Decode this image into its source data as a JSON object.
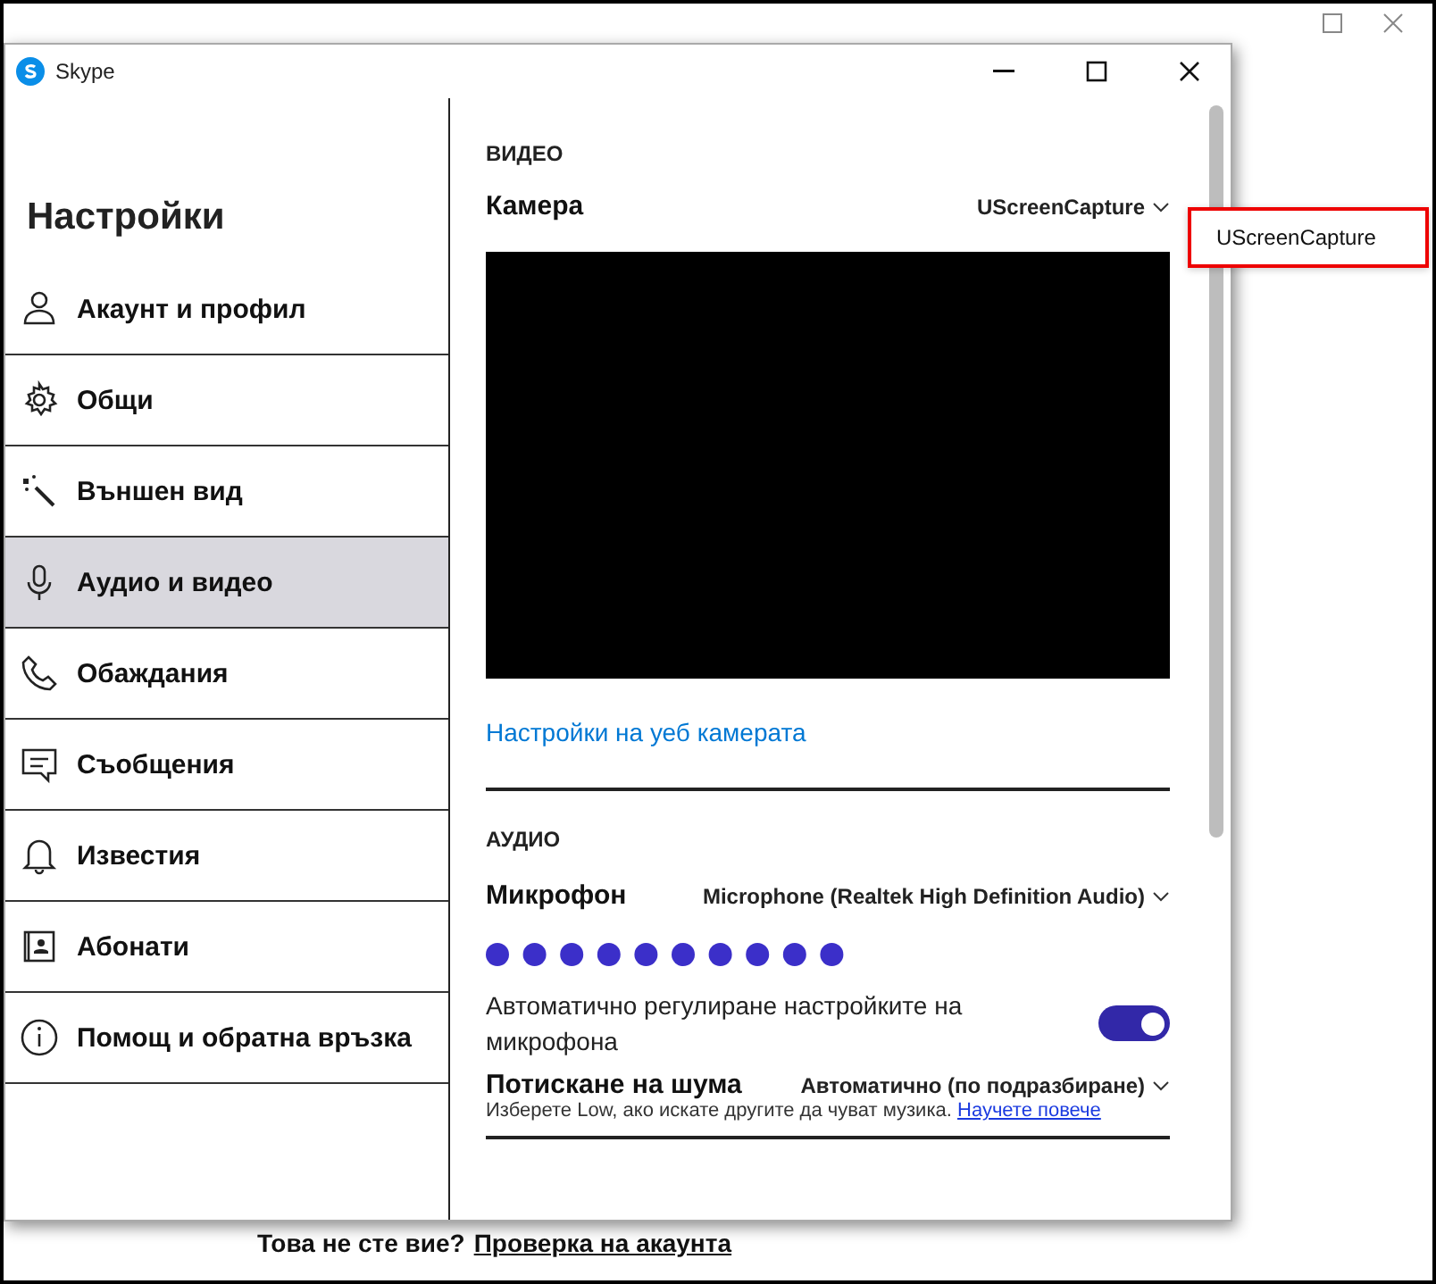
{
  "window": {
    "title": "Skype"
  },
  "sidebar": {
    "title": "Настройки",
    "items": [
      {
        "label": "Акаунт и профил",
        "selected": false
      },
      {
        "label": "Общи",
        "selected": false
      },
      {
        "label": "Външен вид",
        "selected": false
      },
      {
        "label": "Аудио и видео",
        "selected": true
      },
      {
        "label": "Обаждания",
        "selected": false
      },
      {
        "label": "Съобщения",
        "selected": false
      },
      {
        "label": "Известия",
        "selected": false
      },
      {
        "label": "Абонати",
        "selected": false
      },
      {
        "label": "Помощ и обратна връзка",
        "selected": false
      }
    ]
  },
  "video": {
    "heading": "ВИДЕО",
    "camera_label": "Камера",
    "camera_value": "UScreenCapture",
    "webcam_link": "Настройки на уеб камерата"
  },
  "camera_menu": {
    "items": [
      {
        "label": "UScreenCapture",
        "selected": true
      }
    ]
  },
  "audio": {
    "heading": "АУДИО",
    "microphone_label": "Микрофон",
    "microphone_value": "Microphone (Realtek High Definition Audio)",
    "auto_adjust": {
      "label": "Автоматично регулиране настройките на микрофона",
      "on": true
    },
    "noise_label": "Потискане на шума",
    "noise_value": "Автоматично (по подразбиране)",
    "noise_hint": "Изберете Low, ако искате другите да чуват музика.",
    "noise_link": "Научете повече"
  },
  "footer": {
    "question": "Това не сте вие?",
    "link": "Проверка на акаунта"
  }
}
